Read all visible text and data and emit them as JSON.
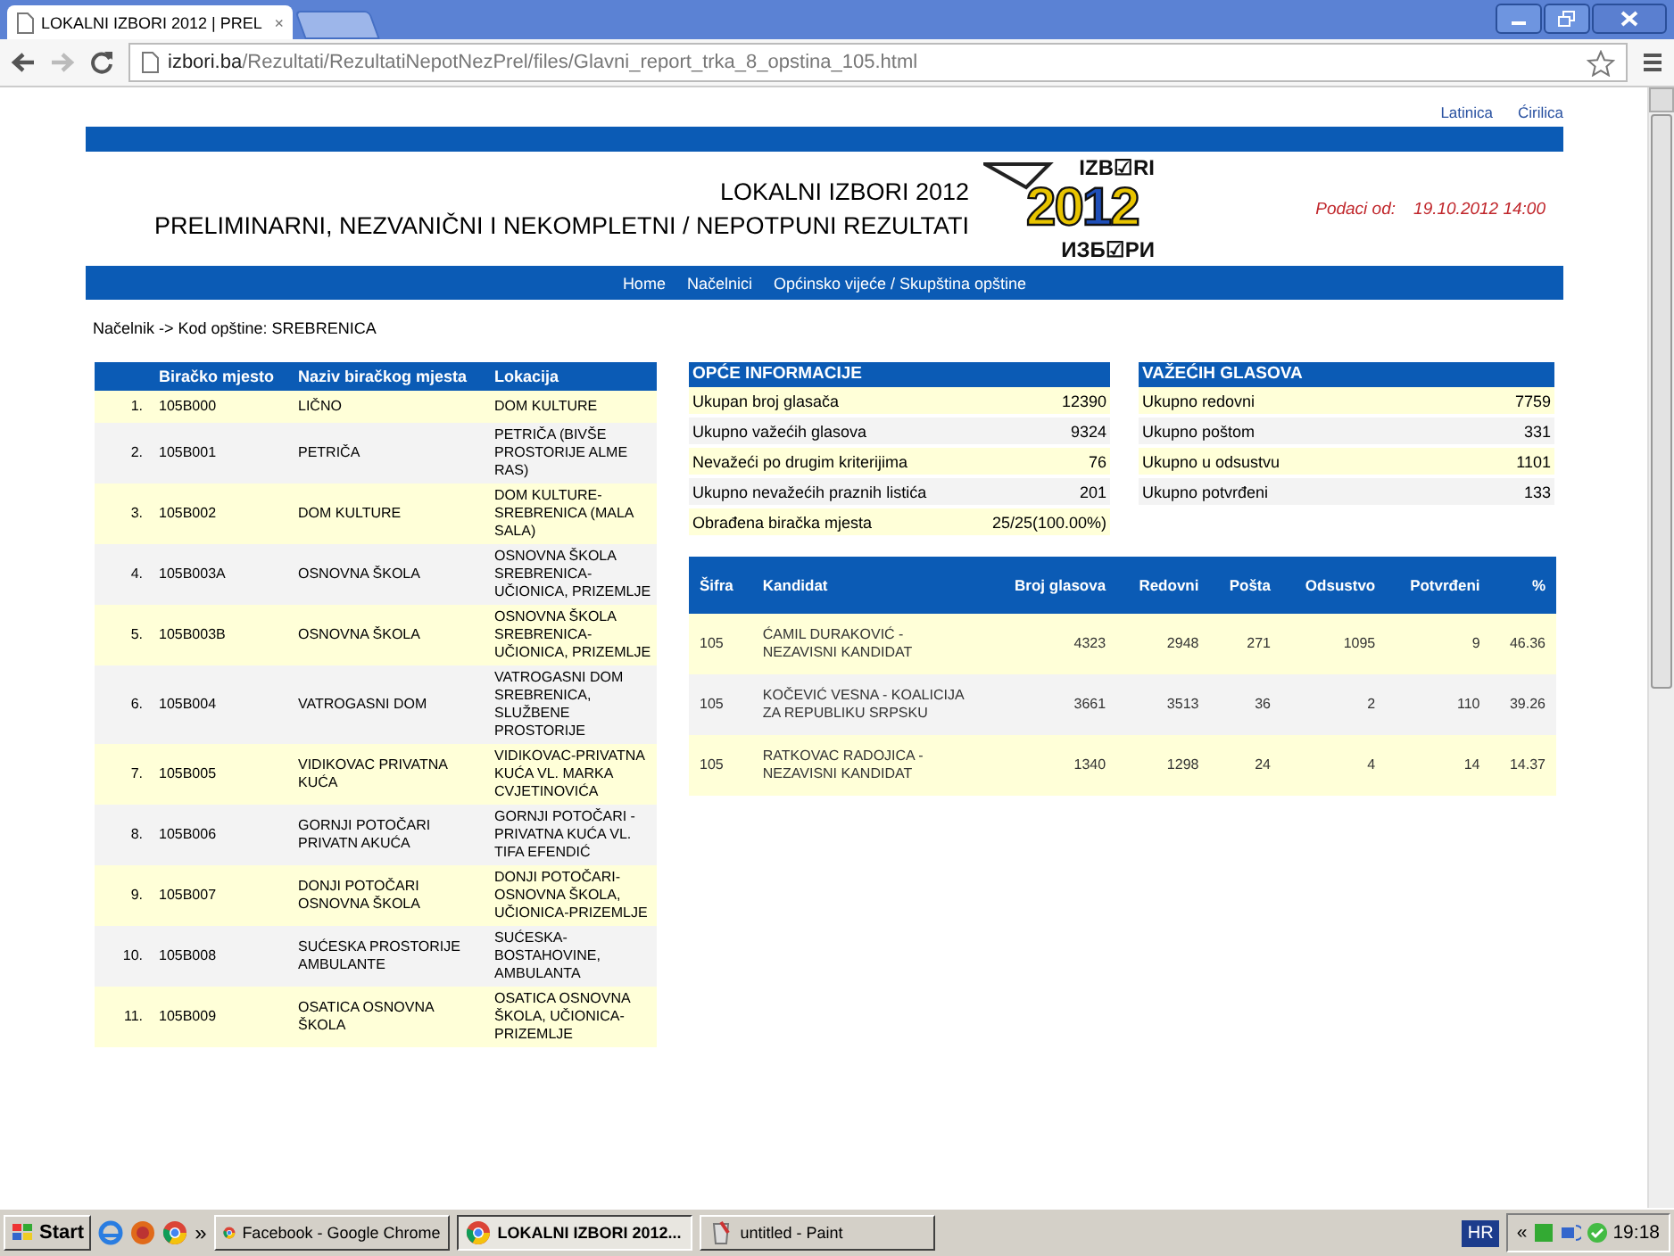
{
  "browser": {
    "tab_title": "LOKALNI IZBORI 2012 | PREL",
    "tab_close": "×",
    "url_host": "izbori.ba",
    "url_path": "/Rezultati/RezultatiNepotNezPrel/files/Glavni_report_trka_8_opstina_105.html"
  },
  "script_links": [
    "Latinica",
    "Ćirilica"
  ],
  "header": {
    "title": "LOKALNI IZBORI 2012",
    "subtitle": "PRELIMINARNI, NEZVANIČNI I NEKOMPLETNI / NEPOTPUNI REZULTATI",
    "logo": {
      "top": "IZB☑RI",
      "year": "2012",
      "bottom": "ИЗБ☑РИ"
    },
    "data_label": "Podaci od:",
    "data_date": "19.10.2012 14:00"
  },
  "nav": [
    "Home",
    "Načelnici",
    "Općinsko vijeće / Skupština opštine"
  ],
  "breadcrumb": "Načelnik -> Kod opštine: SREBRENICA",
  "polling_stations": {
    "columns": [
      "Biračko mjesto",
      "Naziv biračkog mjesta",
      "Lokacija"
    ],
    "rows": [
      {
        "num": "1.",
        "code": "105B000",
        "name": "LIČNO",
        "location": "DOM KULTURE"
      },
      {
        "num": "2.",
        "code": "105B001",
        "name": "PETRIČA",
        "location": "PETRIČA (BIVŠE PROSTORIJE ALME RAS)"
      },
      {
        "num": "3.",
        "code": "105B002",
        "name": "DOM KULTURE",
        "location": "DOM KULTURE-SREBRENICA (MALA SALA)"
      },
      {
        "num": "4.",
        "code": "105B003A",
        "name": "OSNOVNA ŠKOLA",
        "location": "OSNOVNA ŠKOLA SREBRENICA-UČIONICA, PRIZEMLJE"
      },
      {
        "num": "5.",
        "code": "105B003B",
        "name": "OSNOVNA ŠKOLA",
        "location": "OSNOVNA ŠKOLA SREBRENICA-UČIONICA, PRIZEMLJE"
      },
      {
        "num": "6.",
        "code": "105B004",
        "name": "VATROGASNI DOM",
        "location": "VATROGASNI DOM SREBRENICA, SLUŽBENE PROSTORIJE"
      },
      {
        "num": "7.",
        "code": "105B005",
        "name": "VIDIKOVAC PRIVATNA KUĆA",
        "location": "VIDIKOVAC-PRIVATNA KUĆA VL. MARKA CVJETINOVIĆA"
      },
      {
        "num": "8.",
        "code": "105B006",
        "name": "GORNJI POTOČARI PRIVATN AKUĆA",
        "location": "GORNJI POTOČARI - PRIVATNA KUĆA VL. TIFA EFENDIĆ"
      },
      {
        "num": "9.",
        "code": "105B007",
        "name": "DONJI POTOČARI OSNOVNA ŠKOLA",
        "location": "DONJI POTOČARI-OSNOVNA ŠKOLA, UČIONICA-PRIZEMLJE"
      },
      {
        "num": "10.",
        "code": "105B008",
        "name": "SUĆESKA PROSTORIJE AMBULANTE",
        "location": "SUĆESKA-BOSTAHOVINE, AMBULANTA"
      },
      {
        "num": "11.",
        "code": "105B009",
        "name": "OSATICA OSNOVNA ŠKOLA",
        "location": "OSATICA OSNOVNA ŠKOLA, UČIONICA-PRIZEMLJE"
      }
    ]
  },
  "general_info": {
    "title": "OPĆE INFORMACIJE",
    "rows": [
      {
        "label": "Ukupan broj glasača",
        "value": "12390"
      },
      {
        "label": "Ukupno važećih glasova",
        "value": "9324"
      },
      {
        "label": "Nevažeći po drugim kriterijima",
        "value": "76"
      },
      {
        "label": "Ukupno nevažećih praznih listića",
        "value": "201"
      },
      {
        "label": "Obrađena biračka mjesta",
        "value": "25/25(100.00%)"
      }
    ]
  },
  "valid_votes": {
    "title": "VAŽEĆIH GLASOVA",
    "rows": [
      {
        "label": "Ukupno redovni",
        "value": "7759"
      },
      {
        "label": "Ukupno poštom",
        "value": "331"
      },
      {
        "label": "Ukupno u odsustvu",
        "value": "1101"
      },
      {
        "label": "Ukupno potvrđeni",
        "value": "133"
      }
    ]
  },
  "candidates": {
    "columns": [
      "Šifra",
      "Kandidat",
      "Broj glasova",
      "Redovni",
      "Pošta",
      "Odsustvo",
      "Potvrđeni",
      "%"
    ],
    "rows": [
      [
        "105",
        "ĆAMIL DURAKOVIĆ - NEZAVISNI KANDIDAT",
        "4323",
        "2948",
        "271",
        "1095",
        "9",
        "46.36"
      ],
      [
        "105",
        "KOČEVIĆ VESNA - KOALICIJA ZA REPUBLIKU SRPSKU",
        "3661",
        "3513",
        "36",
        "2",
        "110",
        "39.26"
      ],
      [
        "105",
        "RATKOVAC RADOJICA - NEZAVISNI KANDIDAT",
        "1340",
        "1298",
        "24",
        "4",
        "14",
        "14.37"
      ]
    ]
  },
  "taskbar": {
    "start": "Start",
    "more": "»",
    "tasks": [
      {
        "label": "Facebook - Google Chrome",
        "kind": "chrome",
        "selected": false
      },
      {
        "label": "LOKALNI IZBORI 2012...",
        "kind": "chrome",
        "selected": true
      },
      {
        "label": "untitled - Paint",
        "kind": "paint",
        "selected": false
      }
    ],
    "language": "HR",
    "tray_expand": "«",
    "clock": "19:18"
  }
}
